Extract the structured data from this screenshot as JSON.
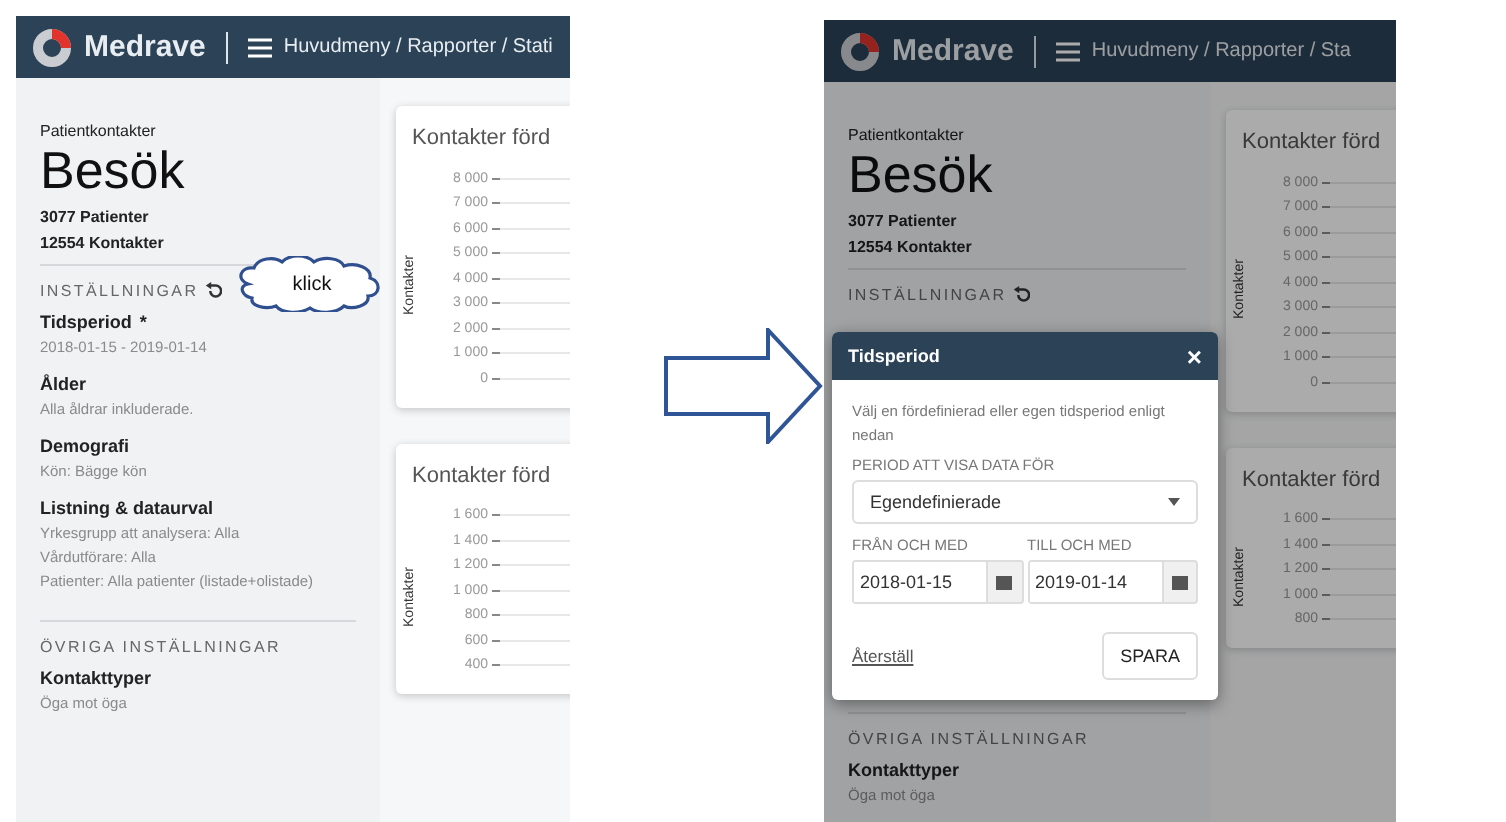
{
  "screens": [
    {
      "header": {
        "brand": "Medrave",
        "breadcrumb": "Huvudmeny / Rapporter / Stati"
      },
      "sidebar": {
        "overline": "Patientkontakter",
        "title": "Besök",
        "stats": [
          "3077 Patienter",
          "12554 Kontakter"
        ],
        "sections": [
          {
            "heading": "INSTÄLLNINGAR",
            "items": [
              {
                "label": "Tidsperiod",
                "marker": "*",
                "values": [
                  "2018-01-15 - 2019-01-14"
                ]
              },
              {
                "label": "Ålder",
                "values": [
                  "Alla åldrar inkluderade."
                ]
              },
              {
                "label": "Demografi",
                "values": [
                  "Kön: Bägge kön"
                ]
              },
              {
                "label": "Listning & dataurval",
                "values": [
                  "Yrkesgrupp att analysera: Alla",
                  "Vårdutförare: Alla",
                  "Patienter: Alla patienter (listade+olistade)"
                ]
              }
            ]
          },
          {
            "heading": "ÖVRIGA INSTÄLLNINGAR",
            "items": [
              {
                "label": "Kontakttyper",
                "values": [
                  "Öga mot öga"
                ]
              }
            ]
          }
        ]
      },
      "cards": [
        {
          "title": "Kontakter förd",
          "axis_label": "Kontakter",
          "ticks": [
            "8 000",
            "7 000",
            "6 000",
            "5 000",
            "4 000",
            "3 000",
            "2 000",
            "1 000",
            "0"
          ]
        },
        {
          "title": "Kontakter förd",
          "axis_label": "Kontakter",
          "ticks": [
            "1 600",
            "1 400",
            "1 200",
            "1 000",
            "800",
            "600",
            "400"
          ]
        }
      ],
      "callout": {
        "text": "klick"
      }
    },
    {
      "header": {
        "brand": "Medrave",
        "breadcrumb": "Huvudmeny / Rapporter / Sta"
      },
      "sidebar": {
        "overline": "Patientkontakter",
        "title": "Besök",
        "stats": [
          "3077 Patienter",
          "12554 Kontakter"
        ],
        "sections": [
          {
            "heading": "INSTÄLLNINGAR"
          },
          {
            "heading": "ÖVRIGA INSTÄLLNINGAR",
            "items": [
              {
                "label": "Kontakttyper",
                "values": [
                  "Öga mot öga"
                ]
              }
            ]
          }
        ]
      },
      "cards": [
        {
          "title": "Kontakter förd",
          "axis_label": "Kontakter",
          "ticks": [
            "8 000",
            "7 000",
            "6 000",
            "5 000",
            "4 000",
            "3 000",
            "2 000",
            "1 000",
            "0"
          ]
        },
        {
          "title": "Kontakter förd",
          "axis_label": "Kontakter",
          "ticks": [
            "1 600",
            "1 400",
            "1 200",
            "1 000",
            "800"
          ]
        }
      ],
      "modal": {
        "title": "Tidsperiod",
        "close": "×",
        "description": "Välj en fördefinierad eller egen tidsperiod enligt nedan",
        "period_label": "PERIOD ATT VISA DATA FÖR",
        "period_value": "Egendefinierade",
        "from": {
          "label": "FRÅN OCH MED",
          "value": "2018-01-15"
        },
        "to": {
          "label": "TILL OCH MED",
          "value": "2019-01-14"
        },
        "reset": "Återställ",
        "save": "SPARA"
      }
    }
  ]
}
